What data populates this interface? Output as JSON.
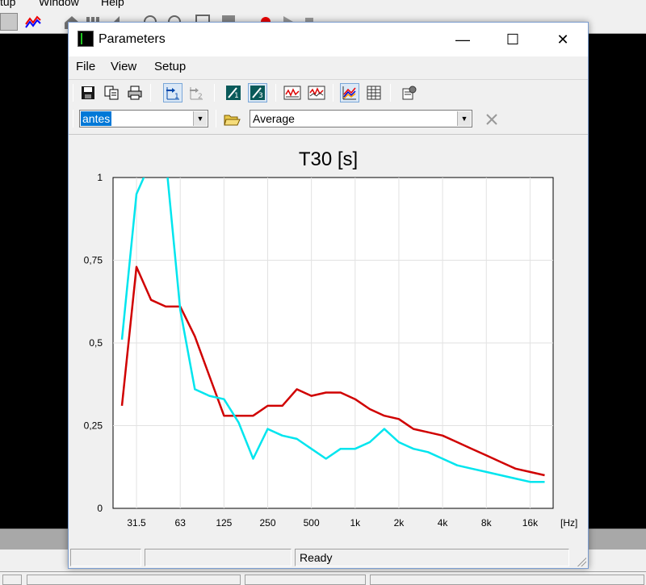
{
  "background_app": {
    "menu_items": [
      "tup",
      "Window",
      "Help"
    ]
  },
  "window": {
    "title": "Parameters",
    "controls": {
      "minimize": "—",
      "maximize": "☐",
      "close": "✕"
    }
  },
  "menubar": {
    "file": "File",
    "view": "View",
    "setup": "Setup"
  },
  "toolbar": {
    "icons": [
      "save-icon",
      "copy-icon",
      "print-icon",
      "octave-1-icon",
      "octave-2-icon",
      "band-1-1-icon",
      "band-1-3-icon",
      "graph-a-icon",
      "graph-b-icon",
      "multi-line-icon",
      "table-icon",
      "settings-icon"
    ]
  },
  "selectors": {
    "measurement_value": "antes",
    "average_value": "Average"
  },
  "status": {
    "text": "Ready"
  },
  "colors": {
    "red_series": "#d00000",
    "cyan_series": "#00e5ee"
  },
  "chart_data": {
    "type": "line",
    "title": "T30 [s]",
    "x_unit": "[Hz]",
    "x_ticks": [
      "31.5",
      "63",
      "125",
      "250",
      "500",
      "1k",
      "2k",
      "4k",
      "8k",
      "16k"
    ],
    "y_ticks": [
      "0",
      "0,25",
      "0,5",
      "0,75",
      "1"
    ],
    "ylim": [
      0,
      1
    ],
    "grid": true,
    "bands": [
      "25",
      "31.5",
      "40",
      "50",
      "63",
      "80",
      "100",
      "125",
      "160",
      "200",
      "250",
      "315",
      "400",
      "500",
      "630",
      "800",
      "1k",
      "1.25k",
      "1.6k",
      "2k",
      "2.5k",
      "3.15k",
      "4k",
      "5k",
      "6.3k",
      "8k",
      "10k",
      "12.5k",
      "16k",
      "20k"
    ],
    "series": [
      {
        "color": "#d00000",
        "values": [
          0.31,
          0.73,
          0.63,
          0.61,
          0.61,
          0.52,
          0.4,
          0.28,
          0.28,
          0.28,
          0.31,
          0.31,
          0.36,
          0.34,
          0.35,
          0.35,
          0.33,
          0.3,
          0.28,
          0.27,
          0.24,
          0.23,
          0.22,
          0.2,
          0.18,
          0.16,
          0.14,
          0.12,
          0.11,
          0.1
        ]
      },
      {
        "color": "#00e5ee",
        "values": [
          0.51,
          0.95,
          1.05,
          1.06,
          0.6,
          0.36,
          0.34,
          0.33,
          0.26,
          0.15,
          0.24,
          0.22,
          0.21,
          0.18,
          0.15,
          0.18,
          0.18,
          0.2,
          0.24,
          0.2,
          0.18,
          0.17,
          0.15,
          0.13,
          0.12,
          0.11,
          0.1,
          0.09,
          0.08,
          0.08
        ]
      }
    ]
  }
}
